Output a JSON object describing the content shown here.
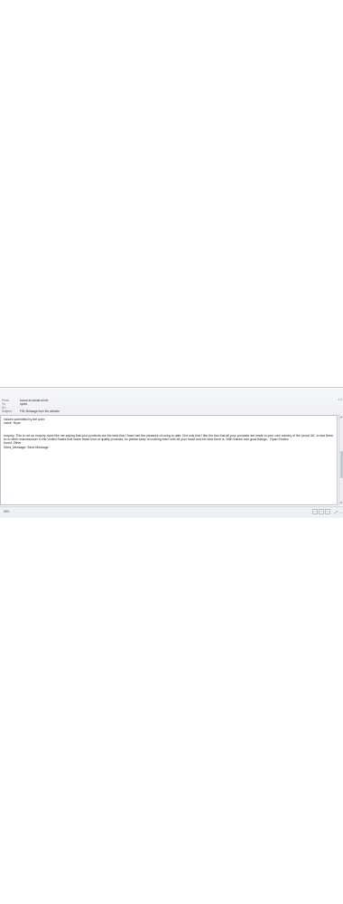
{
  "header": {
    "from_label": "From:",
    "from_value": "kumar.ss.kamal.al.info",
    "to_label": "To:",
    "to_value": "sykes",
    "cc_label": "Cc:",
    "cc_value": "",
    "subject_label": "Subject:",
    "subject_value": "FW: Message from the website",
    "time": "1:1"
  },
  "body": {
    "intro": "Values submitted by the user:",
    "name_line": "name: Ryan",
    "enquiry": "enquiry: This is not an enquiry more like me saying that your products are the best that I have had the pleasure of using to date. Not only that I like the fact that all your products are made in your own country of the proud UK. In fact there is no other manufacturer in the United States that make these kind of quality products, so please keep on making them with all your heart and the best there is. With thanks and good tidings... Ryan Enders",
    "found_line": "found: Other",
    "send_line": "Send_Message: Send Message"
  },
  "status": {
    "zoom": "98%",
    "view_buttons": [
      "▭",
      "▭",
      "▭"
    ]
  }
}
